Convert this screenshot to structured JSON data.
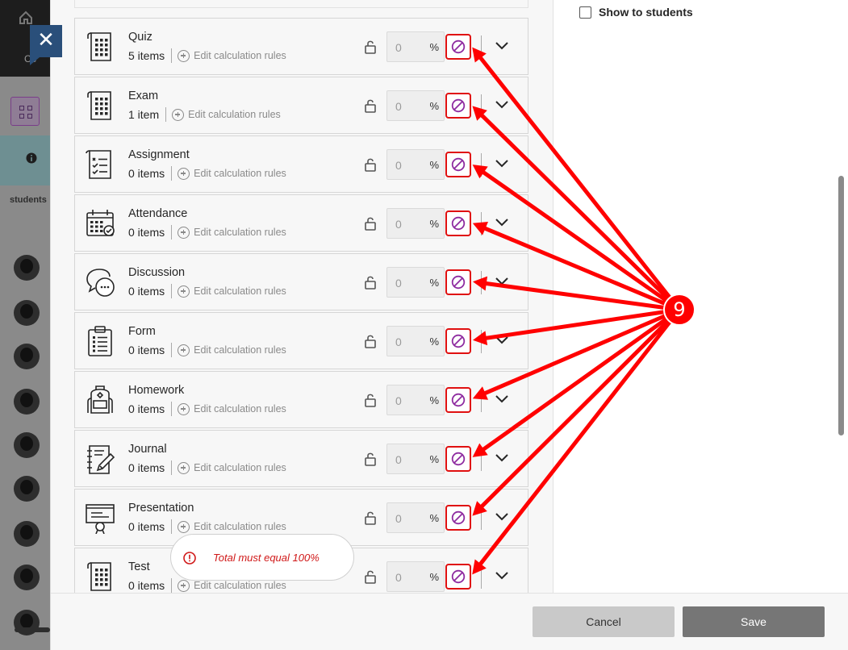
{
  "background": {
    "students_label": "students",
    "partial_text": "Co"
  },
  "right_panel": {
    "show_to_students_label": "Show to students"
  },
  "categories": [
    {
      "name": "Quiz",
      "count": "5 items",
      "rule_label": "Edit calculation rules",
      "weight": "0",
      "percent_symbol": "%",
      "icon": "quiz-icon"
    },
    {
      "name": "Exam",
      "count": "1 item",
      "rule_label": "Edit calculation rules",
      "weight": "0",
      "percent_symbol": "%",
      "icon": "exam-icon"
    },
    {
      "name": "Assignment",
      "count": "0 items",
      "rule_label": "Edit calculation rules",
      "weight": "0",
      "percent_symbol": "%",
      "icon": "assignment-icon"
    },
    {
      "name": "Attendance",
      "count": "0 items",
      "rule_label": "Edit calculation rules",
      "weight": "0",
      "percent_symbol": "%",
      "icon": "attendance-icon"
    },
    {
      "name": "Discussion",
      "count": "0 items",
      "rule_label": "Edit calculation rules",
      "weight": "0",
      "percent_symbol": "%",
      "icon": "discussion-icon"
    },
    {
      "name": "Form",
      "count": "0 items",
      "rule_label": "Edit calculation rules",
      "weight": "0",
      "percent_symbol": "%",
      "icon": "form-icon"
    },
    {
      "name": "Homework",
      "count": "0 items",
      "rule_label": "Edit calculation rules",
      "weight": "0",
      "percent_symbol": "%",
      "icon": "homework-icon"
    },
    {
      "name": "Journal",
      "count": "0 items",
      "rule_label": "Edit calculation rules",
      "weight": "0",
      "percent_symbol": "%",
      "icon": "journal-icon"
    },
    {
      "name": "Presentation",
      "count": "0 items",
      "rule_label": "Edit calculation rules",
      "weight": "0",
      "percent_symbol": "%",
      "icon": "presentation-icon"
    },
    {
      "name": "Test",
      "count": "0 items",
      "rule_label": "Edit calculation rules",
      "weight": "0",
      "percent_symbol": "%",
      "icon": "test-icon"
    }
  ],
  "toast": {
    "message": "Total must equal 100%"
  },
  "footer": {
    "cancel_label": "Cancel",
    "save_label": "Save"
  },
  "annotation": {
    "badge_number": "9",
    "color": "#ff0000"
  },
  "colors": {
    "drop_icon": "#8e2ba0",
    "highlight_border": "#e01010",
    "save_bg": "#767676",
    "cancel_bg": "#c9c9c9",
    "error_text": "#d01818"
  }
}
